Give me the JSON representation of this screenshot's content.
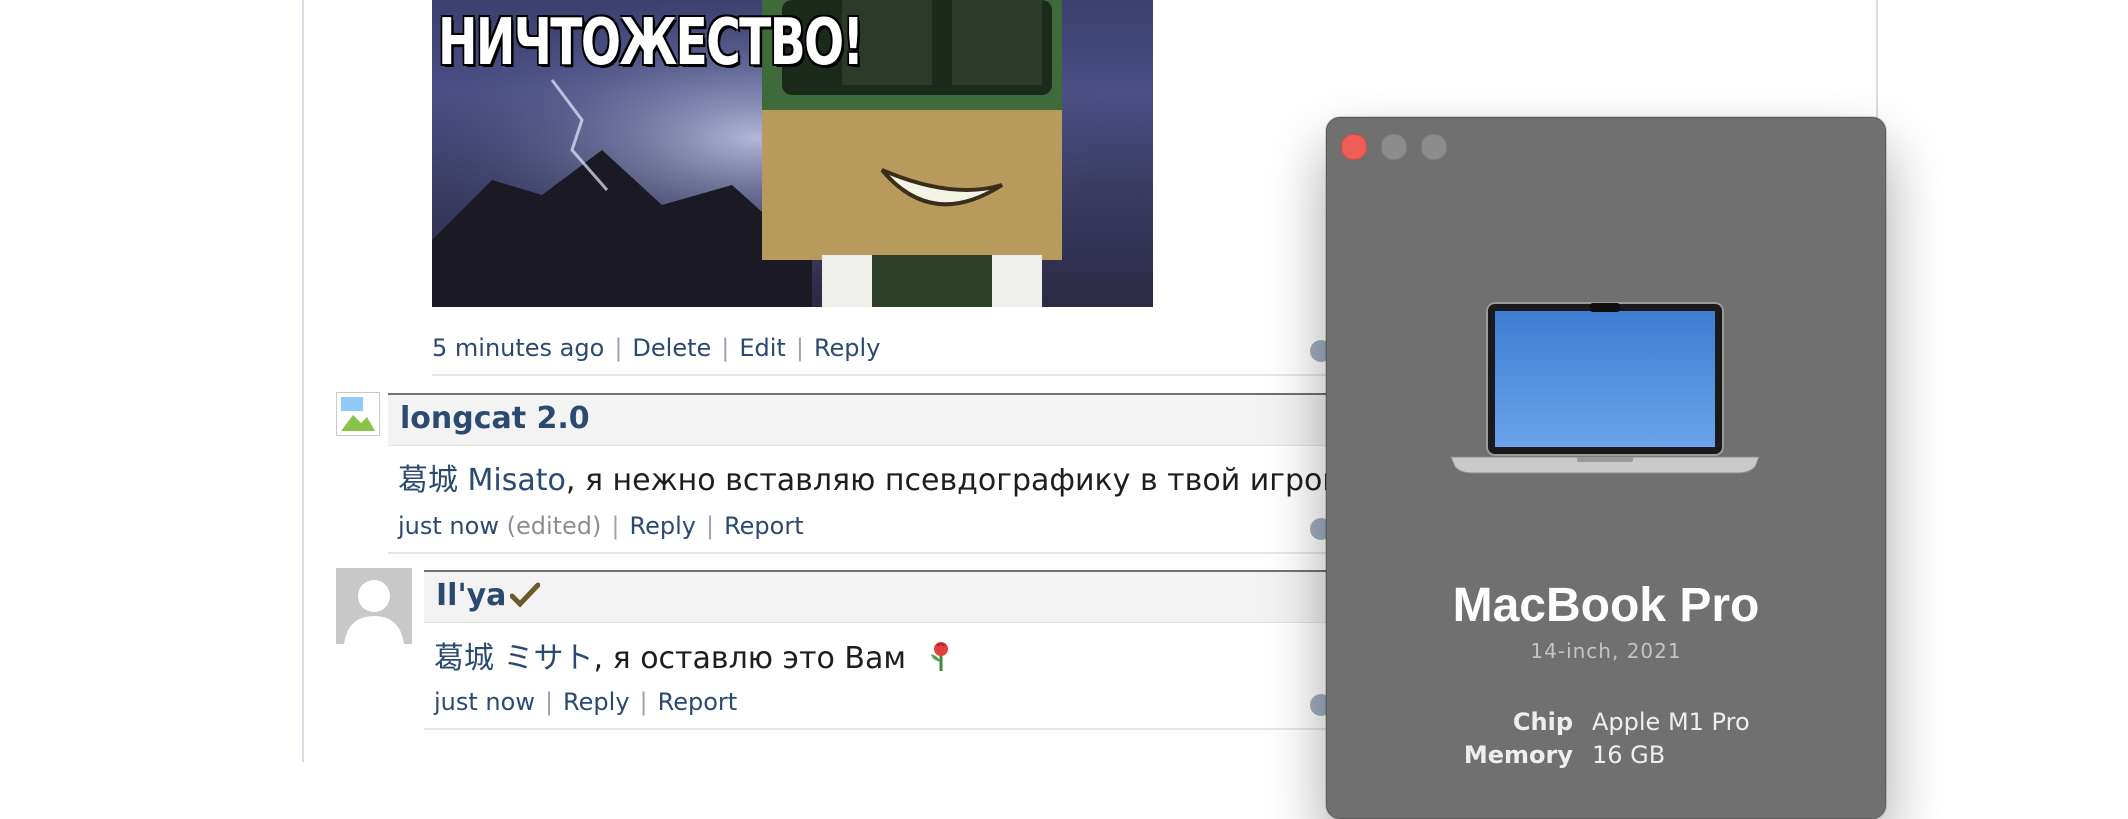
{
  "post": {
    "meme_caption": "НИЧТОЖЕСТВО!",
    "time": "5 minutes ago",
    "actions": [
      "Delete",
      "Edit",
      "Reply"
    ]
  },
  "comments": [
    {
      "author": "longcat 2.0",
      "mention": "葛城 Misato",
      "text": ", я нежно вставляю псевдографику в твой игровой пк",
      "time": "just now",
      "edited": "(edited)",
      "actions": [
        "Reply",
        "Report"
      ]
    },
    {
      "author": "Il'ya",
      "verified_icon": "checkmark-icon",
      "mention": "葛城 ミサト",
      "text": ", я оставлю это Вам",
      "emoji_icon": "rose-icon",
      "time": "just now",
      "actions": [
        "Reply",
        "Report"
      ]
    }
  ],
  "about_mac": {
    "model": "MacBook Pro",
    "subtitle": "14-inch, 2021",
    "specs": [
      {
        "key": "Chip",
        "value": "Apple M1 Pro"
      },
      {
        "key": "Memory",
        "value": "16 GB"
      }
    ]
  },
  "colors": {
    "link": "#2b4a6f",
    "window_bg": "#707070",
    "close_button": "#ee5e57"
  }
}
